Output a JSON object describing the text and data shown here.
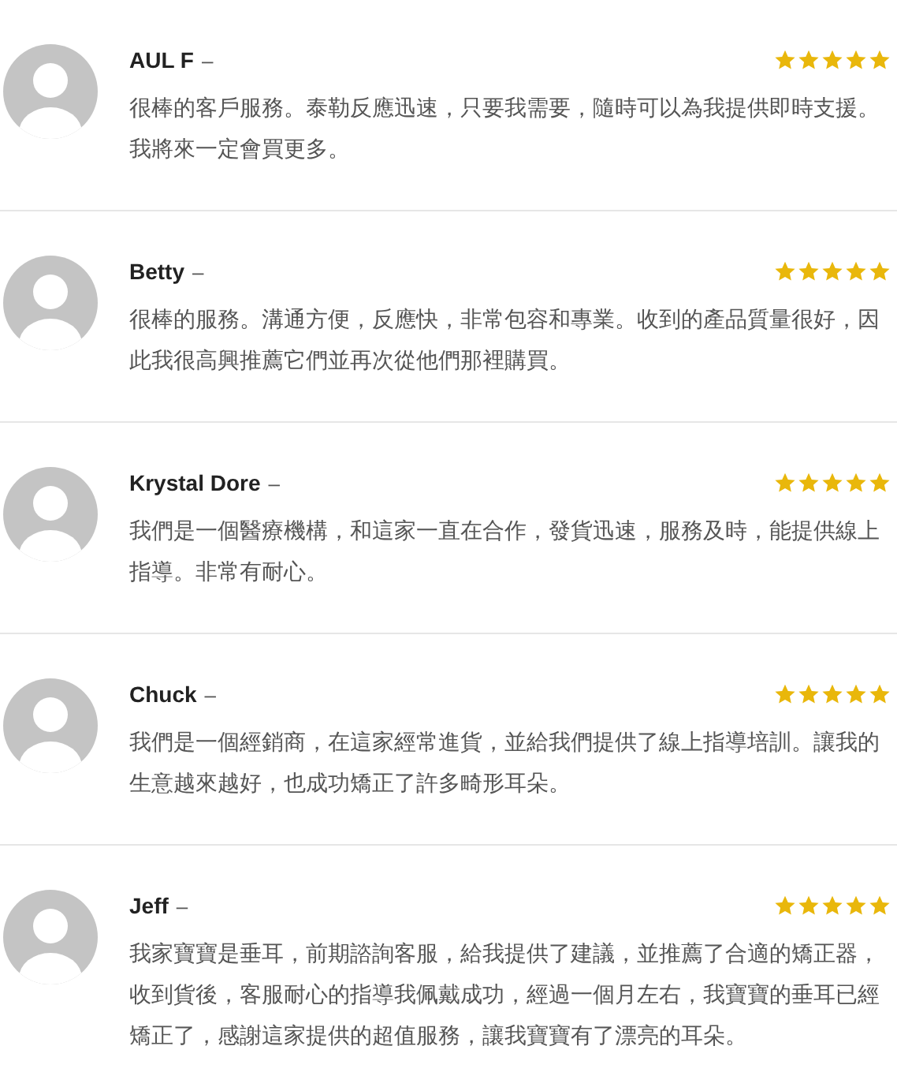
{
  "reviews": [
    {
      "name": "AUL F",
      "separator": "–",
      "stars": 5,
      "text": "很棒的客戶服務。泰勒反應迅速，只要我需要，隨時可以為我提供即時支援。我將來一定會買更多。"
    },
    {
      "name": "Betty",
      "separator": "–",
      "stars": 5,
      "text": "很棒的服務。溝通方便，反應快，非常包容和專業。收到的產品質量很好，因此我很高興推薦它們並再次從他們那裡購買。"
    },
    {
      "name": "Krystal Dore",
      "separator": "–",
      "stars": 5,
      "text": "我們是一個醫療機構，和這家一直在合作，發貨迅速，服務及時，能提供線上指導。非常有耐心。"
    },
    {
      "name": "Chuck",
      "separator": "–",
      "stars": 5,
      "text": "我們是一個經銷商，在這家經常進貨，並給我們提供了線上指導培訓。讓我的生意越來越好，也成功矯正了許多畸形耳朵。"
    },
    {
      "name": "Jeff",
      "separator": "–",
      "stars": 5,
      "text": "我家寶寶是垂耳，前期諮詢客服，給我提供了建議，並推薦了合適的矯正器，收到貨後，客服耐心的指導我佩戴成功，經過一個月左右，我寶寶的垂耳已經矯正了，感謝這家提供的超值服務，讓我寶寶有了漂亮的耳朵。"
    }
  ]
}
